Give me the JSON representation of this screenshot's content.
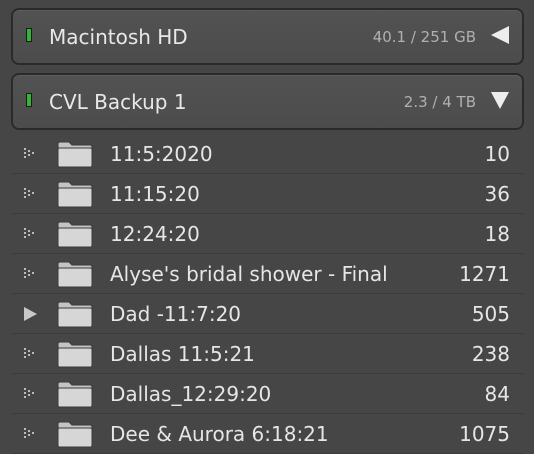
{
  "volumes": [
    {
      "name": "Macintosh HD",
      "usage": "40.1 / 251 GB",
      "indicator_color": "#33b533",
      "toggle_icon": "triangle-left-icon"
    },
    {
      "name": "CVL Backup 1",
      "usage": "2.3 / 4 TB",
      "indicator_color": "#33b533",
      "toggle_icon": "triangle-down-icon"
    }
  ],
  "folders": [
    {
      "name": "11:5:2020",
      "count": "10",
      "disclosure": "dotted-triangle-icon"
    },
    {
      "name": "11:15:20",
      "count": "36",
      "disclosure": "dotted-triangle-icon"
    },
    {
      "name": "12:24:20",
      "count": "18",
      "disclosure": "dotted-triangle-icon"
    },
    {
      "name": "Alyse's bridal shower - Final",
      "count": "1271",
      "disclosure": "dotted-triangle-icon"
    },
    {
      "name": "Dad -11:7:20",
      "count": "505",
      "disclosure": "solid-triangle-icon"
    },
    {
      "name": "Dallas 11:5:21",
      "count": "238",
      "disclosure": "dotted-triangle-icon"
    },
    {
      "name": "Dallas_12:29:20",
      "count": "84",
      "disclosure": "dotted-triangle-icon"
    },
    {
      "name": "Dee & Aurora 6:18:21",
      "count": "1075",
      "disclosure": "dotted-triangle-icon"
    }
  ]
}
